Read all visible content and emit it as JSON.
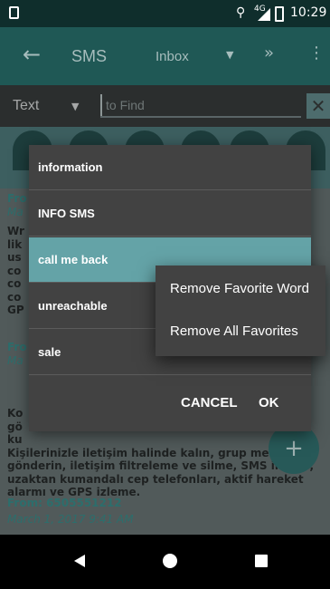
{
  "status_bar": {
    "time": "10:29",
    "network": "4G"
  },
  "toolbar": {
    "title": "SMS",
    "folder": "Inbox"
  },
  "search": {
    "type": "Text",
    "placeholder": "to Find"
  },
  "messages": [
    {
      "from": "Fro",
      "date": "Ma",
      "body": [
        "Wr",
        "lik",
        "us",
        "co",
        "co",
        "co",
        "GP"
      ]
    },
    {
      "from": "Fro",
      "date": "Ma",
      "body": [
        "Ko",
        "gö",
        "ku",
        "Kişilerinizle iletişim halinde kalın, grup metinleri",
        "gönderin, iletişim filtreleme ve silme, SMS iletme,",
        "uzaktan kumandalı cep telefonları, aktif hareket",
        "alarmı ve GPS izleme."
      ]
    },
    {
      "from": "From:  6505551212",
      "date": "March 1, 2017 9:41 AM"
    }
  ],
  "dialog": {
    "items": [
      "information",
      "INFO SMS",
      "call me back",
      "unreachable",
      "sale"
    ],
    "selected_index": 2,
    "cancel_label": "CANCEL",
    "ok_label": "OK"
  },
  "popup": {
    "items": [
      "Remove Favorite Word",
      "Remove All Favorites"
    ]
  },
  "fab": {
    "label": "+"
  },
  "colors": {
    "accent": "#64a3a7",
    "dialog_bg": "#424242",
    "toolbar": "#1f5855"
  }
}
